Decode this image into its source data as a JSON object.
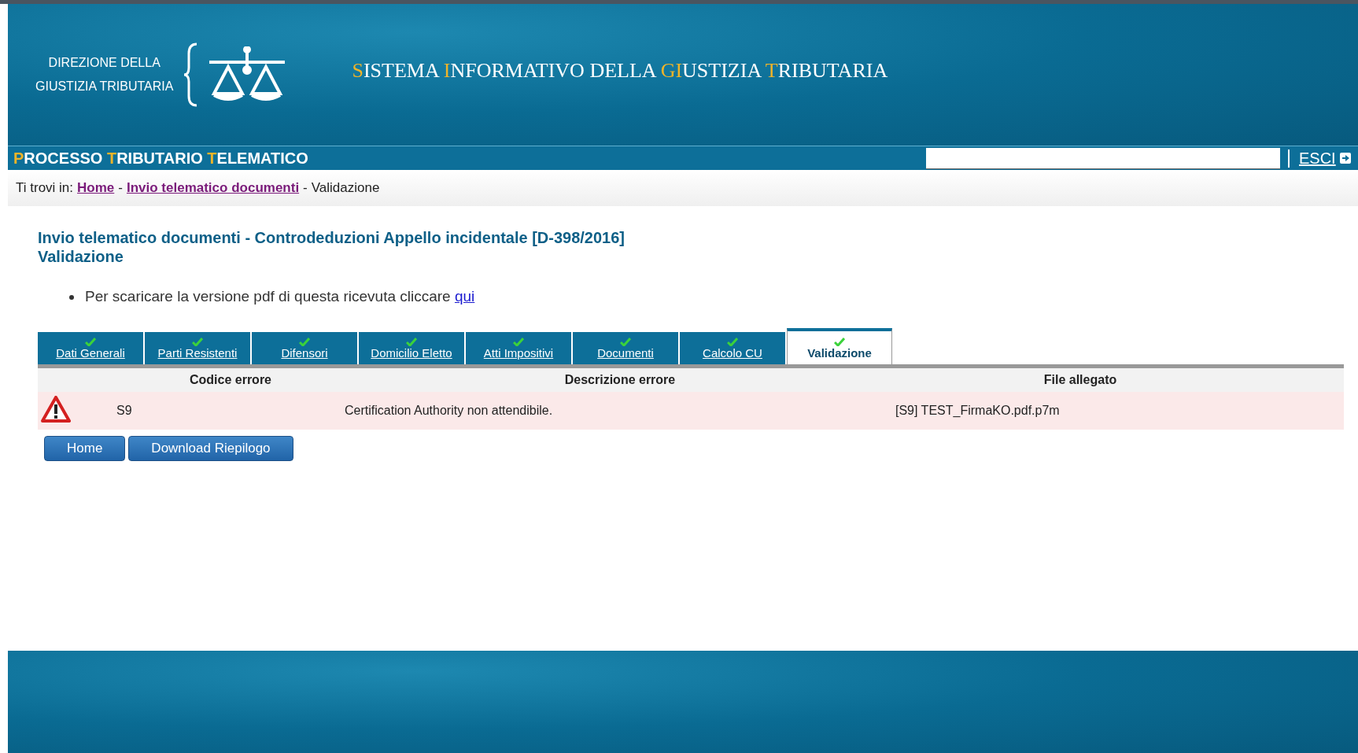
{
  "header": {
    "org_lines": [
      "DIREZIONE DELLA",
      "GIUSTIZIA TRIBUTARIA"
    ],
    "title": [
      {
        "text": "S",
        "accent": true
      },
      {
        "text": "ISTEMA ",
        "accent": false
      },
      {
        "text": "I",
        "accent": true
      },
      {
        "text": "NFORMATIVO DELLA ",
        "accent": false
      },
      {
        "text": "GI",
        "accent": true
      },
      {
        "text": "USTIZIA ",
        "accent": false
      },
      {
        "text": "T",
        "accent": true
      },
      {
        "text": "RIBUTARIA",
        "accent": false
      }
    ]
  },
  "navbar": {
    "title": [
      {
        "text": "P",
        "accent": true
      },
      {
        "text": "ROCESSO ",
        "accent": false
      },
      {
        "text": "T",
        "accent": true
      },
      {
        "text": "RIBUTARIO ",
        "accent": false
      },
      {
        "text": "T",
        "accent": true
      },
      {
        "text": "ELEMATICO",
        "accent": false
      }
    ],
    "logout": "ESCI"
  },
  "breadcrumb": {
    "prefix": "Ti trovi in:",
    "items": [
      {
        "label": "Home",
        "kind": "link"
      },
      {
        "label": "-",
        "kind": "separator"
      },
      {
        "label": "Invio telematico documenti",
        "kind": "link"
      },
      {
        "label": "-",
        "kind": "separator"
      },
      {
        "label": "Validazione",
        "kind": "current"
      }
    ]
  },
  "page_title": [
    "Invio telematico documenti - Controdeduzioni Appello incidentale [D-398/2016]",
    "Validazione"
  ],
  "notice": {
    "text": "Per scaricare la versione pdf di questa ricevuta cliccare",
    "link": "qui"
  },
  "tabs": [
    {
      "label": "Dati Generali",
      "selected": false,
      "done": true
    },
    {
      "label": "Parti Resistenti",
      "selected": false,
      "done": true
    },
    {
      "label": "Difensori",
      "selected": false,
      "done": true
    },
    {
      "label": "Domicilio Eletto",
      "selected": false,
      "done": true
    },
    {
      "label": "Atti Impositivi",
      "selected": false,
      "done": true
    },
    {
      "label": "Documenti",
      "selected": false,
      "done": true
    },
    {
      "label": "Calcolo CU",
      "selected": false,
      "done": true
    },
    {
      "label": "Validazione",
      "selected": true,
      "done": true
    }
  ],
  "table": {
    "columns": [
      "Codice errore",
      "Descrizione errore",
      "File allegato"
    ],
    "rows": [
      {
        "warning": true,
        "code": "S9",
        "description": "Certification Authority non attendibile.",
        "file": "[S9] TEST_FirmaKO.pdf.p7m"
      }
    ]
  },
  "buttons": [
    "Home",
    "Download Riepilogo"
  ]
}
